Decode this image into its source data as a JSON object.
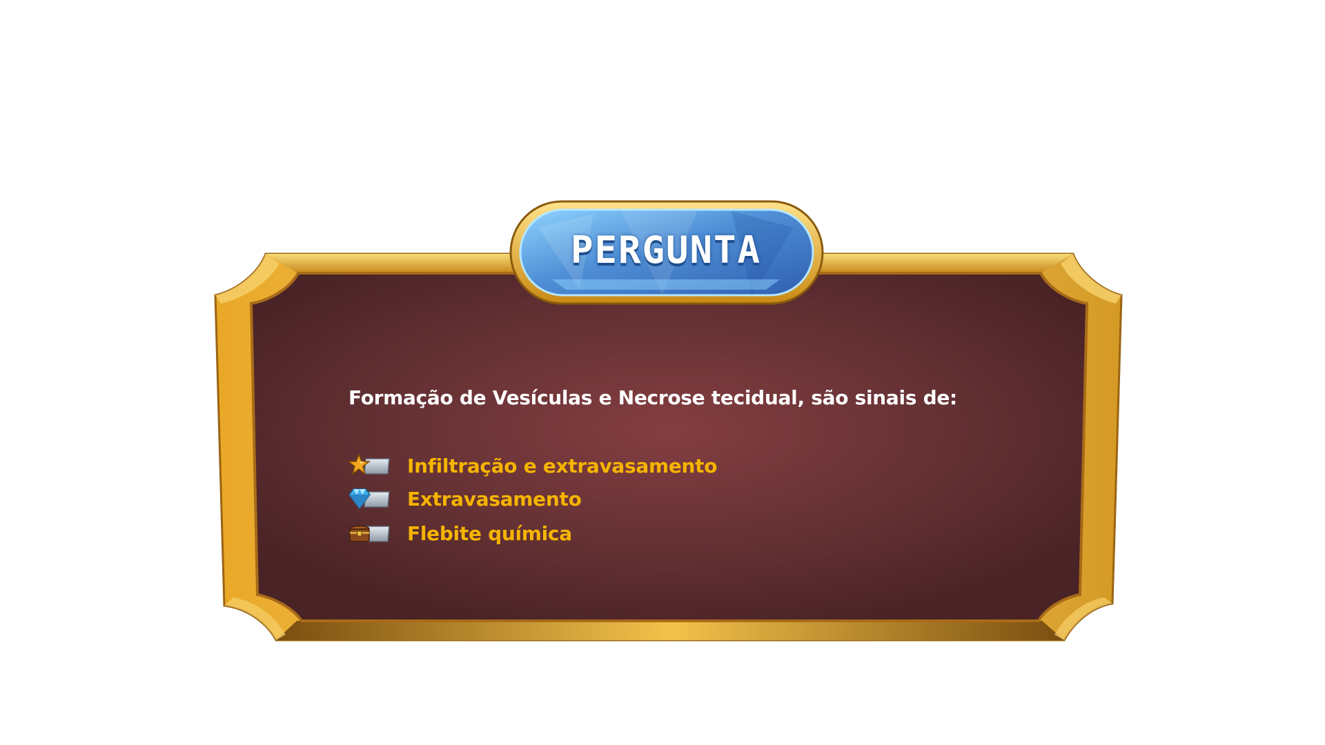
{
  "header": {
    "title": "PERGUNTA"
  },
  "question": {
    "text": "Formação de Vesículas e Necrose tecidual, são sinais de:"
  },
  "answers": [
    {
      "label": "Infiltração e extravasamento",
      "icon": "star-icon"
    },
    {
      "label": "Extravasamento",
      "icon": "diamond-icon"
    },
    {
      "label": "Flebite química",
      "icon": "treasure-chest-icon"
    }
  ],
  "colors": {
    "panel": "#6e3538",
    "frame_gold": "#e8b12e",
    "answer_text": "#f5b400",
    "question_text": "#ffffff",
    "title_gem": "#4f8fd6"
  }
}
